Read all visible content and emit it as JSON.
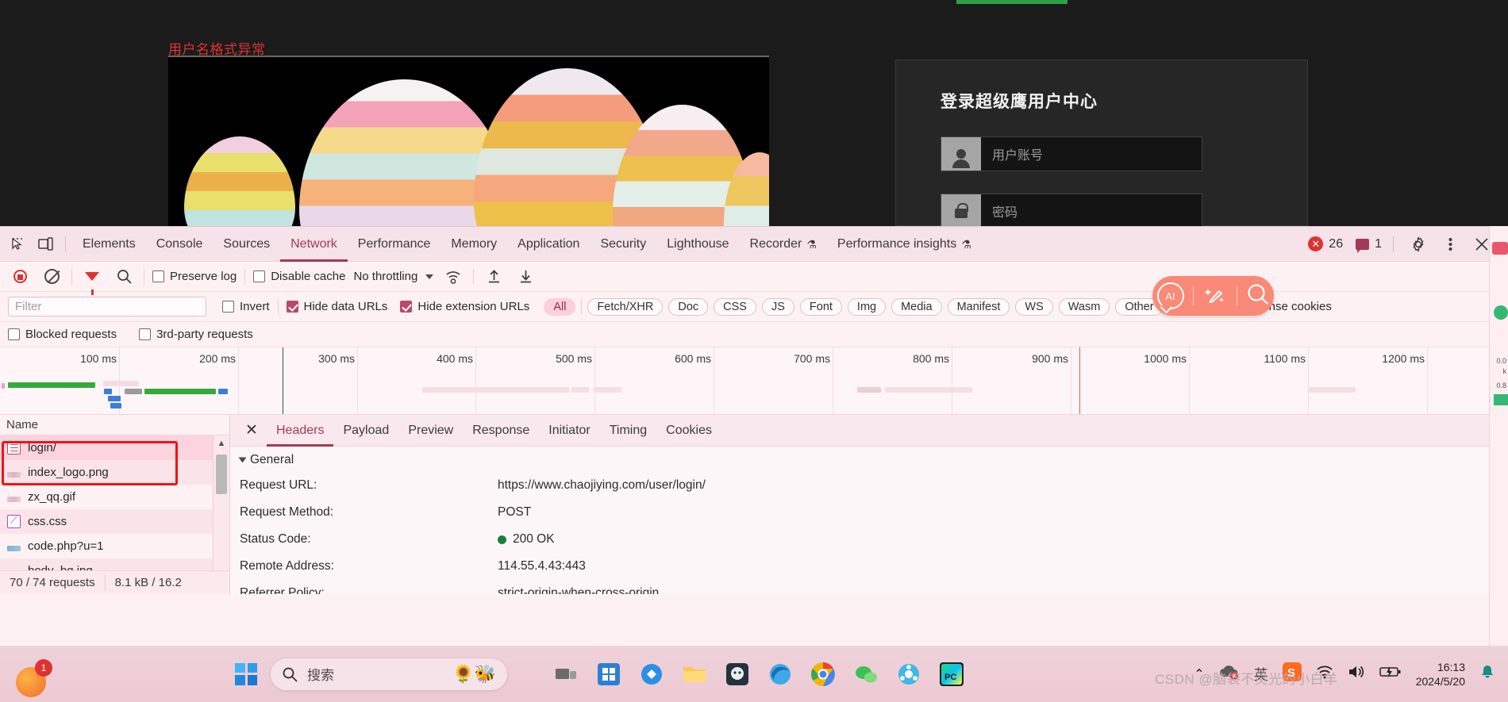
{
  "webpage": {
    "error_text": "用户名格式异常",
    "login_card": {
      "title": "登录超级鹰用户中心",
      "username_placeholder": "用户账号",
      "password_placeholder": "密码"
    }
  },
  "devtools": {
    "tabs": [
      {
        "label": "Elements",
        "active": false,
        "flask": false
      },
      {
        "label": "Console",
        "active": false,
        "flask": false
      },
      {
        "label": "Sources",
        "active": false,
        "flask": false
      },
      {
        "label": "Network",
        "active": true,
        "flask": false
      },
      {
        "label": "Performance",
        "active": false,
        "flask": false
      },
      {
        "label": "Memory",
        "active": false,
        "flask": false
      },
      {
        "label": "Application",
        "active": false,
        "flask": false
      },
      {
        "label": "Security",
        "active": false,
        "flask": false
      },
      {
        "label": "Lighthouse",
        "active": false,
        "flask": false
      },
      {
        "label": "Recorder",
        "active": false,
        "flask": true
      },
      {
        "label": "Performance insights",
        "active": false,
        "flask": true
      }
    ],
    "error_count": "26",
    "message_count": "1",
    "flask_glyph": "⚗",
    "network_toolbar": {
      "record_title": "record",
      "clear_title": "clear",
      "filter_title": "filter",
      "search_title": "search",
      "preserve_log": "Preserve log",
      "preserve_log_checked": false,
      "disable_cache": "Disable cache",
      "disable_cache_checked": false,
      "throttling": "No throttling",
      "import_title": "import-har",
      "export_title": "export-har"
    },
    "filter_bar": {
      "filter_placeholder": "Filter",
      "filter_value": "",
      "invert": "Invert",
      "invert_checked": false,
      "hide_data_urls": "Hide data URLs",
      "hide_data_urls_checked": true,
      "hide_extension_urls": "Hide extension URLs",
      "hide_extension_urls_checked": true,
      "types": [
        "All",
        "Fetch/XHR",
        "Doc",
        "CSS",
        "JS",
        "Font",
        "Img",
        "Media",
        "Manifest",
        "WS",
        "Wasm",
        "Other"
      ],
      "selected_type": "All",
      "blocked_response_cookies": "Blocked response cookies",
      "blocked_response_cookies_checked": false
    },
    "options_row": {
      "blocked_requests": "Blocked requests",
      "blocked_requests_checked": false,
      "third_party": "3rd-party requests",
      "third_party_checked": false
    },
    "timeline": {
      "ticks": [
        "100 ms",
        "200 ms",
        "300 ms",
        "400 ms",
        "500 ms",
        "600 ms",
        "700 ms",
        "800 ms",
        "900 ms",
        "1000 ms",
        "1100 ms",
        "1200 ms"
      ]
    },
    "requests": {
      "column_header": "Name",
      "rows": [
        {
          "name": "login/",
          "icon": "doc-icon",
          "selected": true
        },
        {
          "name": "index_logo.png",
          "icon": "image-icon",
          "selected": false
        },
        {
          "name": "zx_qq.gif",
          "icon": "image-icon",
          "selected": false
        },
        {
          "name": "css.css",
          "icon": "stylesheet-icon",
          "selected": false
        },
        {
          "name": "code.php?u=1",
          "icon": "script-icon",
          "selected": false
        },
        {
          "name": "body_bg.jpg",
          "icon": "image-icon",
          "selected": false
        }
      ]
    },
    "status_bar": {
      "requests": "70 / 74 requests",
      "transferred": "8.1 kB / 16.2"
    },
    "detail": {
      "close_label": "✕",
      "tabs": [
        {
          "label": "Headers",
          "active": true
        },
        {
          "label": "Payload",
          "active": false
        },
        {
          "label": "Preview",
          "active": false
        },
        {
          "label": "Response",
          "active": false
        },
        {
          "label": "Initiator",
          "active": false
        },
        {
          "label": "Timing",
          "active": false
        },
        {
          "label": "Cookies",
          "active": false
        }
      ],
      "general_title": "General",
      "general_rows": [
        {
          "key": "Request URL:",
          "value": "https://www.chaojiying.com/user/login/",
          "status_dot": false
        },
        {
          "key": "Request Method:",
          "value": "POST",
          "status_dot": false
        },
        {
          "key": "Status Code:",
          "value": "200 OK",
          "status_dot": true
        },
        {
          "key": "Remote Address:",
          "value": "114.55.4.43:443",
          "status_dot": false
        },
        {
          "key": "Referrer Policy:",
          "value": "strict-origin-when-cross-origin",
          "status_dot": false
        }
      ]
    },
    "float_tool": {
      "ai_label": "AI"
    }
  },
  "taskbar": {
    "search_placeholder": "搜索",
    "fox_badge": "1",
    "ime_label": "英",
    "sogou_label": "S",
    "pycharm_label": "PC",
    "time": "16:13",
    "date": "2024/5/20",
    "watermark": "CSDN @脑袋不灵光的小白羊"
  },
  "colors": {
    "accent": "#a33a55",
    "checkbox": "#b84a68",
    "error": "#e03131",
    "ok": "#188038",
    "theme_bg": "#fdf1f4",
    "tabbar_bg": "#f6e2e9",
    "float_tool": "#fa8977"
  }
}
